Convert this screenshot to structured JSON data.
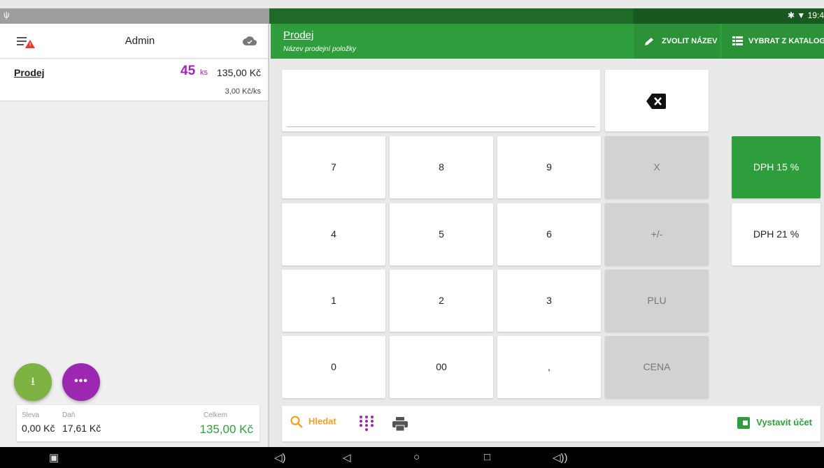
{
  "status_bar": {
    "left_icon": "usb-icon",
    "right_text": "✱ ▼ 19:4"
  },
  "left_panel": {
    "user": "Admin",
    "order": {
      "name": "Prodej",
      "qty": "45",
      "unit": "ks",
      "price": "135,00 Kč",
      "price_per_unit": "3,00 Kč/ks"
    },
    "fab_download": "⭳",
    "fab_more": "•••",
    "totals": {
      "discount_label": "Sleva",
      "discount_value": "0,00 Kč",
      "tax_label": "Daň",
      "tax_value": "17,61 Kč",
      "total_label": "Celkem",
      "total_value": "135,00 Kč"
    }
  },
  "header": {
    "title": "Prodej",
    "subtitle": "Název prodejní položky",
    "rename_label": "ZVOLIT NÁZEV",
    "catalog_label": "VYBRAT Z KATALOGU"
  },
  "keypad": {
    "display": "",
    "keys": [
      "7",
      "8",
      "9",
      "X",
      "4",
      "5",
      "6",
      "+/-",
      "1",
      "2",
      "3",
      "PLU",
      "0",
      "00",
      ",",
      "CENA"
    ]
  },
  "vat": {
    "option1": "DPH 15 %",
    "option2": "DPH 21 %"
  },
  "bottom_bar": {
    "search_label": "Hledat",
    "pay_label": "Vystavit účet"
  },
  "nav": {
    "camera": "▣",
    "vol_down": "◁)",
    "back": "◁",
    "home": "○",
    "recents": "□",
    "vol_up": "◁))"
  },
  "colors": {
    "brand_green": "#2e9e3c",
    "accent_purple": "#9c27b0",
    "search_orange": "#f0a023"
  }
}
